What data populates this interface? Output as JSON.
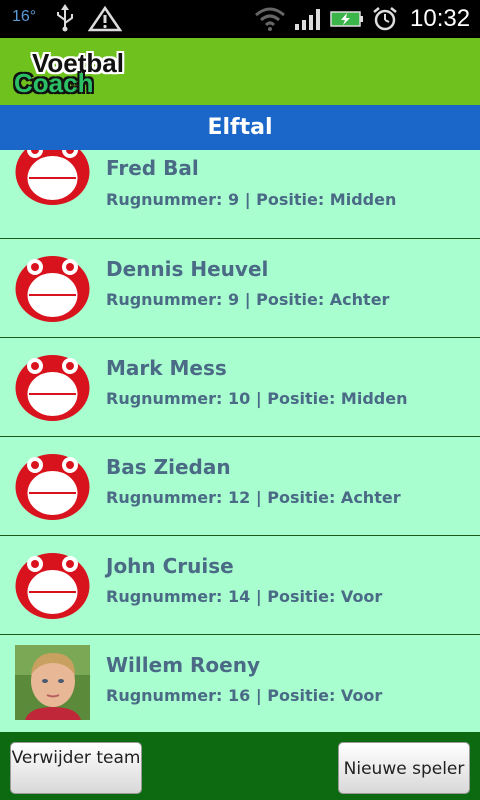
{
  "status_bar": {
    "temperature": "16°",
    "time": "10:32",
    "icons": [
      "usb-icon",
      "warning-icon",
      "wifi-icon",
      "signal-icon",
      "battery-charging-icon",
      "alarm-icon"
    ]
  },
  "app": {
    "logo_line1": "Voetbal",
    "logo_line2": "Coach",
    "screen_title": "Elftal"
  },
  "players": [
    {
      "name": "Fred Bal",
      "info": "Rugnummer: 9 | Positie: Midden",
      "avatar": "placeholder-face-icon"
    },
    {
      "name": "Dennis Heuvel",
      "info": "Rugnummer: 9 | Positie: Achter",
      "avatar": "placeholder-face-icon"
    },
    {
      "name": "Mark Mess",
      "info": "Rugnummer: 10 | Positie: Midden",
      "avatar": "placeholder-face-icon"
    },
    {
      "name": "Bas Ziedan",
      "info": "Rugnummer: 12 | Positie: Achter",
      "avatar": "placeholder-face-icon"
    },
    {
      "name": "John Cruise",
      "info": "Rugnummer: 14 | Positie: Voor",
      "avatar": "placeholder-face-icon"
    },
    {
      "name": "Willem Roeny",
      "info": "Rugnummer: 16 | Positie: Voor",
      "avatar": "player-photo"
    }
  ],
  "buttons": {
    "delete_team": "Verwijder team",
    "new_player": "Nieuwe speler"
  },
  "colors": {
    "app_bar": "#6fc11e",
    "title_bar": "#1a66c9",
    "list_background": "#a8fecf",
    "bottom_bar": "#0e6a10",
    "text": "#4a6a86"
  }
}
